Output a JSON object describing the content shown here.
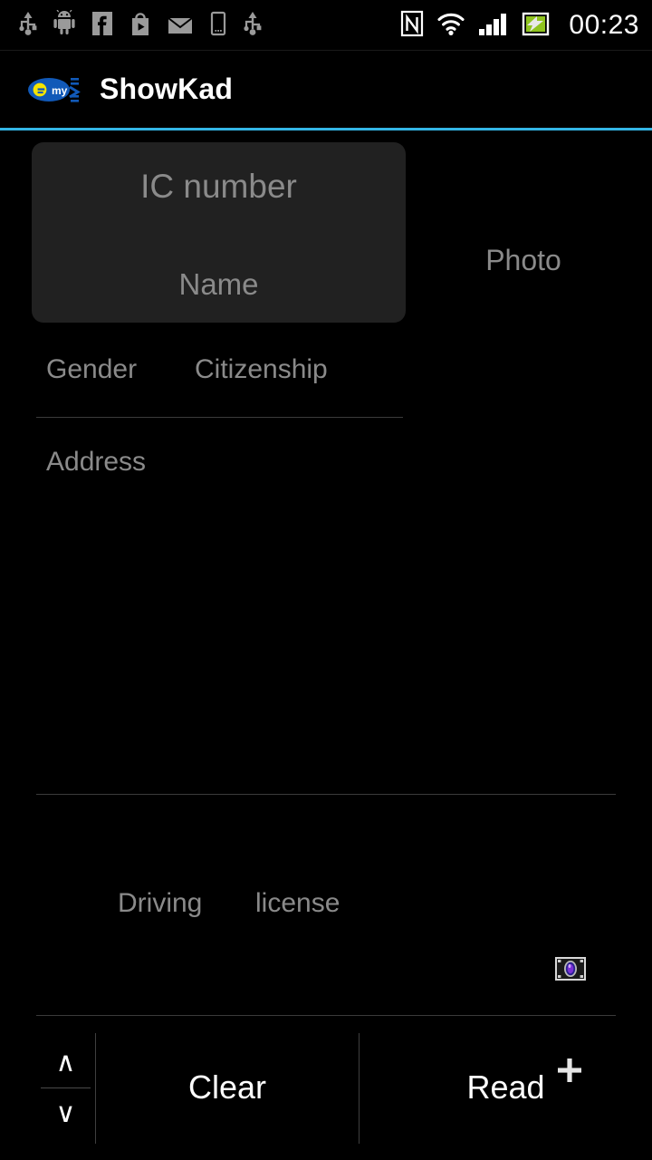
{
  "status_bar": {
    "icons_left": [
      {
        "name": "usb-icon",
        "label": "USB"
      },
      {
        "name": "android-debug-icon",
        "label": "Android"
      },
      {
        "name": "facebook-icon",
        "label": "Facebook"
      },
      {
        "name": "play-store-icon",
        "label": "Play Store"
      },
      {
        "name": "email-icon",
        "label": "Email"
      },
      {
        "name": "device-icon",
        "label": "Device"
      },
      {
        "name": "usb-icon-2",
        "label": "USB"
      }
    ],
    "icons_right": [
      {
        "name": "nfc-icon",
        "label": "NFC"
      },
      {
        "name": "wifi-icon",
        "label": "Wi-Fi"
      },
      {
        "name": "cellular-signal-icon",
        "label": "Signal"
      },
      {
        "name": "battery-charging-icon",
        "label": "Battery charging"
      }
    ],
    "clock": "00:23",
    "battery_color": "#8fc31f"
  },
  "action_bar": {
    "title": "ShowKad",
    "logo_name": "mykad-logo",
    "logo_text_e": "e",
    "logo_text_my": "my",
    "accent_color": "#33b5e5"
  },
  "form": {
    "ic_number": "IC number",
    "name": "Name",
    "photo": "Photo",
    "gender": "Gender",
    "citizenship": "Citizenship",
    "address": "Address",
    "driving": "Driving",
    "license": "license",
    "hint_color": "#8a8a8a",
    "panel_color": "#212121"
  },
  "icons": {
    "camera": "camera-icon",
    "add": "plus-icon"
  },
  "bottom_bar": {
    "stepper_up": "∧",
    "stepper_down": "∨",
    "clear_label": "Clear",
    "read_label": "Read"
  }
}
